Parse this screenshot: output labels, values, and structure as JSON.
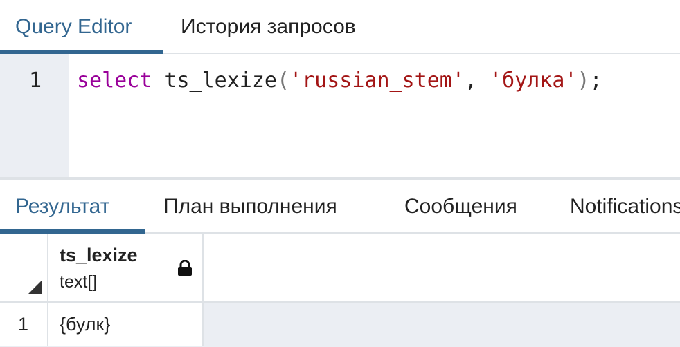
{
  "editor_tabs": [
    {
      "label": "Query Editor",
      "active": true
    },
    {
      "label": "История запросов",
      "active": false
    }
  ],
  "editor": {
    "line_number": "1",
    "tokens": {
      "keyword": "select",
      "func": " ts_lexize",
      "open_paren": "(",
      "arg1": "'russian_stem'",
      "comma": ", ",
      "arg2": "'булка'",
      "close_paren": ")",
      "semicolon": ";"
    }
  },
  "result_tabs": [
    {
      "label": "Результат",
      "active": true
    },
    {
      "label": "План выполнения",
      "active": false
    },
    {
      "label": "Сообщения",
      "active": false
    },
    {
      "label": "Notifications",
      "active": false
    }
  ],
  "grid": {
    "columns": [
      {
        "name": "ts_lexize",
        "type": "text[]",
        "icon": "lock-icon"
      }
    ],
    "rows": [
      {
        "row_number": "1",
        "cells": [
          "{булк}"
        ]
      }
    ]
  },
  "colors": {
    "accent": "#326690",
    "keyword": "#990099",
    "string": "#a31515",
    "gutter": "#ebeef3"
  }
}
